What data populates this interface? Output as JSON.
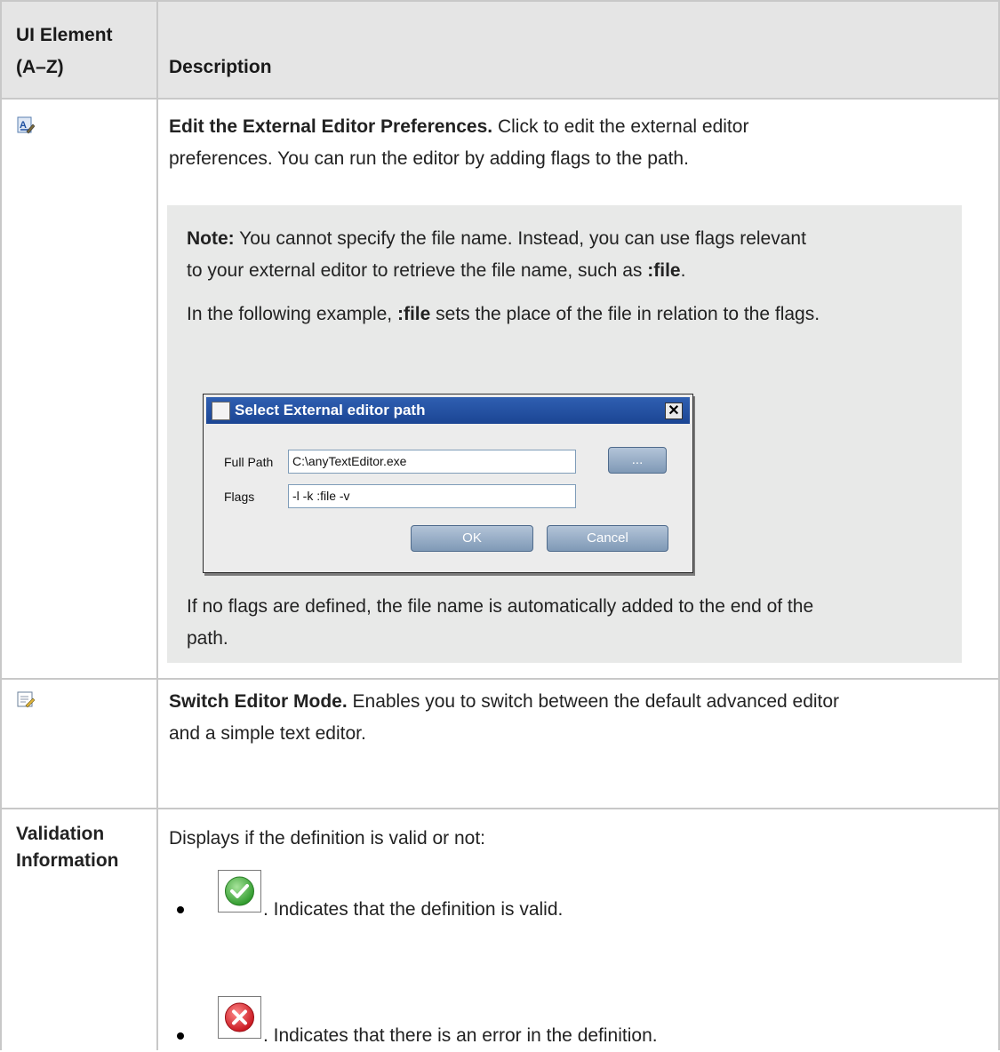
{
  "header": {
    "col1": "UI Element (A–Z)",
    "col1_line1": "UI Element",
    "col1_line2": "(A–Z)",
    "col2": "Description"
  },
  "rows": [
    {
      "element_icon": "edit-external-editor-icon",
      "title": "Edit the External Editor Preferences.",
      "line1": "Click to edit the external editor",
      "line2": "preferences. You can run the editor by adding flags to the path.",
      "note": {
        "label": "Note:",
        "line1": "You cannot specify the file name. Instead, you can use flags relevant",
        "line2_pre": "to your external editor to retrieve the file name, such as ",
        "line2_bold": ":file",
        "line2_post": ".",
        "line3_pre": "In the following example, ",
        "line3_bold": ":file",
        "line3_post": " sets the place of the file in relation to the flags.",
        "dialog": {
          "title": "Select External editor path",
          "full_path_label": "Full Path",
          "full_path_value": "C:\\anyTextEditor.exe",
          "browse_label": "...",
          "flags_label": "Flags",
          "flags_value": "-l -k :file -v",
          "ok_label": "OK",
          "cancel_label": "Cancel",
          "close_glyph": "✕"
        },
        "after_line1": "If no flags are defined, the file name is automatically added to the end of the",
        "after_line2": "path."
      }
    },
    {
      "element_icon": "switch-editor-mode-icon",
      "title": "Switch Editor Mode.",
      "line1": "Enables you to switch between the default advanced editor",
      "line2": "and a simple text editor."
    },
    {
      "element_line1": "Validation",
      "element_line2": "Information",
      "intro": "Displays if the definition is valid or not:",
      "items": [
        {
          "icon": "valid-check-icon",
          "text": ". Indicates that the definition is valid."
        },
        {
          "icon": "error-x-icon",
          "text": ". Indicates that there is an error in the definition."
        }
      ]
    }
  ],
  "colors": {
    "header_bg": "#e5e5e5",
    "note_bg": "#e8e9e8",
    "grid": "#c8c8c8",
    "valid_green": "#3fae3a",
    "error_red": "#d9232e",
    "dialog_title": "#2f5fb1"
  }
}
